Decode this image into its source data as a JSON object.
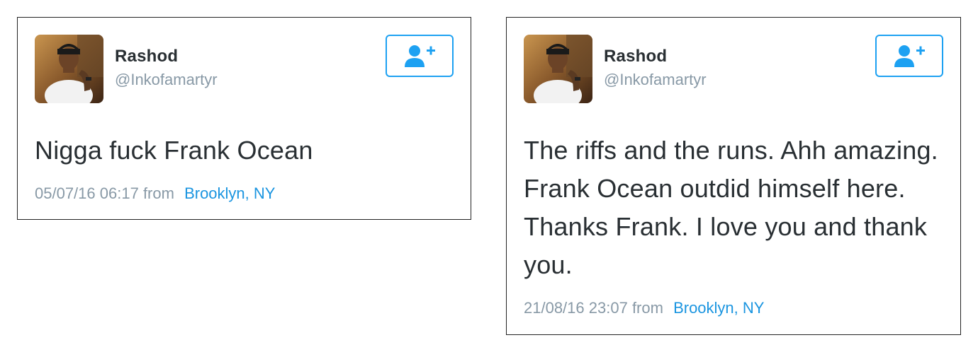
{
  "colors": {
    "accent": "#1da1f2",
    "link": "#1b95e0",
    "text": "#292f33",
    "muted": "#8899a6"
  },
  "tweets": [
    {
      "display_name": "Rashod",
      "handle": "@Inkofamartyr",
      "text": "Nigga fuck Frank Ocean",
      "timestamp": "05/07/16 06:17",
      "from_label": "from",
      "location": "Brooklyn, NY",
      "follow_icon": "add-user-icon"
    },
    {
      "display_name": "Rashod",
      "handle": "@Inkofamartyr",
      "text": "The riffs and the runs. Ahh amazing. Frank Ocean outdid himself here. Thanks Frank. I love you and thank you.",
      "timestamp": "21/08/16 23:07",
      "from_label": "from",
      "location": "Brooklyn, NY",
      "follow_icon": "add-user-icon"
    }
  ]
}
